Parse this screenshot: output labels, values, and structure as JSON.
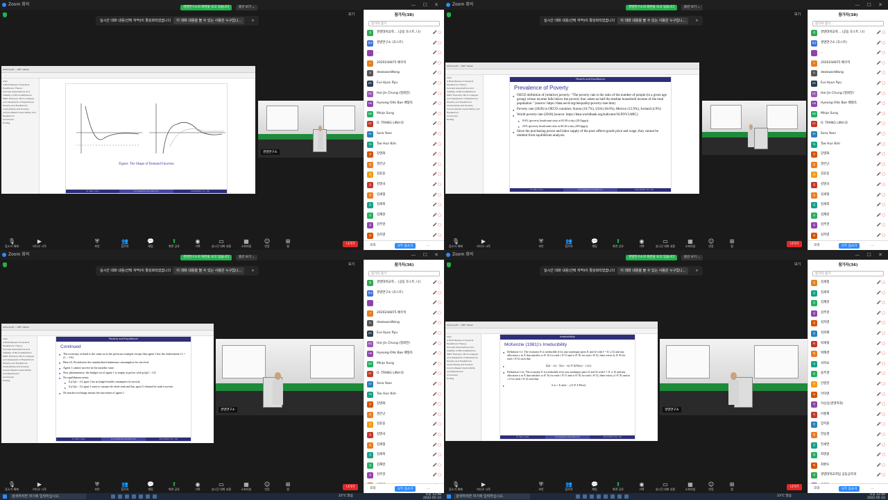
{
  "zoom": {
    "window_title": "Zoom 회의",
    "green_banner": "경영연구소의 화면을 보고 있습니다",
    "view_options": "옵션 보기 ⌄",
    "view_label": "보기",
    "caption_notice": "실시간 대화 내용(선택 자막)이 활성화되었습니다",
    "caption_who": "이 대화 내용을 볼 수 있는 사람은 누구입니...",
    "close": "×",
    "video_name": "경영연구소",
    "leave_label": "나가기"
  },
  "toolbar": {
    "items": [
      {
        "label": "음소거 해제",
        "icon": "mic-icon"
      },
      {
        "label": "비디오 시작",
        "icon": "camera-icon"
      },
      {
        "label": "보안",
        "icon": "shield-icon"
      },
      {
        "label": "참가자",
        "icon": "participants-icon"
      },
      {
        "label": "채팅",
        "icon": "chat-icon"
      },
      {
        "label": "화면 공유",
        "icon": "share-icon"
      },
      {
        "label": "기록",
        "icon": "record-icon"
      },
      {
        "label": "실시간 대화 내용",
        "icon": "cc-icon"
      },
      {
        "label": "소회의실",
        "icon": "breakout-icon"
      },
      {
        "label": "반응",
        "icon": "reaction-icon"
      },
      {
        "label": "앱",
        "icon": "apps-icon"
      }
    ],
    "participant_count_top": "38",
    "participant_count_bottom": "36"
  },
  "panels": {
    "q0": {
      "title": "참가자(38)"
    },
    "q1": {
      "title": "참가자(38)"
    },
    "q2": {
      "title": "참가자(36)"
    },
    "q3": {
      "title": "참가자(36)"
    },
    "search_placeholder": "참가자 찾기",
    "invite": "초대",
    "mute_all": "모두 음소거",
    "more": "...",
    "list_a": [
      {
        "name": "경영대학교학... (공동 호스트, 나)",
        "av": "경",
        "color": "#2fa84f"
      },
      {
        "name": "경영연구소 (호스트)",
        "av": "경영",
        "color": "#3a6fd8"
      },
      {
        "name": "..",
        "av": "",
        "color": "#8e44ad"
      },
      {
        "name": "2020244875 배우미",
        "av": "2",
        "color": "#e67e22"
      },
      {
        "name": "deokwonWang",
        "av": "D",
        "color": "#555"
      },
      {
        "name": "Eui-Hyun Ryu",
        "av": "ER",
        "color": "#2c3e50"
      },
      {
        "name": "Hoi-Jin Chung (정회진)",
        "av": "HC",
        "color": "#9b59b6"
      },
      {
        "name": "Hyeong-Ohk Bae 배형옥",
        "av": "HB",
        "color": "#8e44ad"
      },
      {
        "name": "Minje Sung",
        "av": "MS",
        "color": "#27ae60"
      },
      {
        "name": "O. TRANG LINH D",
        "av": "OT",
        "color": "#c0392b"
      },
      {
        "name": "Sora Yoon",
        "av": "SY",
        "color": "#2980b9"
      },
      {
        "name": "Tae Hun Kim",
        "av": "TK",
        "color": "#16a085"
      },
      {
        "name": "강영화",
        "av": "강",
        "color": "#d35400"
      },
      {
        "name": "권은난",
        "av": "권",
        "color": "#e67e22"
      },
      {
        "name": "김윤웅",
        "av": "김",
        "color": "#f39c12"
      },
      {
        "name": "김영국",
        "av": "김",
        "color": "#c0392b"
      },
      {
        "name": "김세형",
        "av": "김",
        "color": "#e67e22"
      },
      {
        "name": "김세희",
        "av": "김",
        "color": "#16a085"
      },
      {
        "name": "김재현",
        "av": "김",
        "color": "#27ae60"
      },
      {
        "name": "김주현",
        "av": "김",
        "color": "#8e44ad"
      },
      {
        "name": "김지영",
        "av": "김",
        "color": "#d35400"
      }
    ],
    "list_b": [
      {
        "name": "경영대학교학... (공동 호스트, 나)",
        "av": "경",
        "color": "#2fa84f"
      },
      {
        "name": "경영연구소 (호스트)",
        "av": "경영",
        "color": "#3a6fd8"
      },
      {
        "name": "..",
        "av": "",
        "color": "#8e44ad"
      },
      {
        "name": "2020244875 배우미",
        "av": "2",
        "color": "#e67e22"
      },
      {
        "name": "deokwonWang",
        "av": "D",
        "color": "#555"
      },
      {
        "name": "Eui-Hyun Ryu",
        "av": "ER",
        "color": "#2c3e50"
      },
      {
        "name": "Hoi-Jin Chung (정회진)",
        "av": "HC",
        "color": "#9b59b6"
      },
      {
        "name": "Hyeong-Ohk Bae 배형옥",
        "av": "HB",
        "color": "#8e44ad"
      },
      {
        "name": "Minje Sung",
        "av": "MS",
        "color": "#27ae60"
      },
      {
        "name": "O. TRANG LINH D",
        "av": "OT",
        "color": "#c0392b"
      },
      {
        "name": "Sora Yoon",
        "av": "SY",
        "color": "#2980b9"
      },
      {
        "name": "Tae Hun Kim",
        "av": "TK",
        "color": "#16a085"
      },
      {
        "name": "강영화",
        "av": "강",
        "color": "#d35400"
      },
      {
        "name": "권은난",
        "av": "권",
        "color": "#e67e22"
      },
      {
        "name": "김윤웅",
        "av": "김",
        "color": "#f39c12"
      },
      {
        "name": "김영국",
        "av": "김",
        "color": "#c0392b"
      },
      {
        "name": "김세형",
        "av": "김",
        "color": "#e67e22"
      },
      {
        "name": "김세희",
        "av": "김",
        "color": "#16a085"
      },
      {
        "name": "김재현",
        "av": "김",
        "color": "#27ae60"
      },
      {
        "name": "김주현",
        "av": "김",
        "color": "#8e44ad"
      },
      {
        "name": "김지영",
        "av": "김",
        "color": "#d35400"
      },
      {
        "name": "김희영",
        "av": "김",
        "color": "#2980b9"
      }
    ],
    "list_c": [
      {
        "name": "김세형",
        "av": "김",
        "color": "#e67e22"
      },
      {
        "name": "김세희",
        "av": "김",
        "color": "#16a085"
      },
      {
        "name": "김재현",
        "av": "김",
        "color": "#27ae60"
      },
      {
        "name": "김주현",
        "av": "김",
        "color": "#8e44ad"
      },
      {
        "name": "김지영",
        "av": "김",
        "color": "#d35400"
      },
      {
        "name": "김희재",
        "av": "김",
        "color": "#2980b9"
      },
      {
        "name": "박세형",
        "av": "박",
        "color": "#c0392b"
      },
      {
        "name": "박혜경",
        "av": "박",
        "color": "#e67e22"
      },
      {
        "name": "서지요",
        "av": "서",
        "color": "#16a085"
      },
      {
        "name": "송주경",
        "av": "송",
        "color": "#27ae60"
      },
      {
        "name": "안정현",
        "av": "안",
        "color": "#f39c12"
      },
      {
        "name": "이덕영",
        "av": "이",
        "color": "#d35400"
      },
      {
        "name": "이상심(경영학과)",
        "av": "이",
        "color": "#8e44ad"
      },
      {
        "name": "이홍재",
        "av": "이",
        "color": "#c0392b"
      },
      {
        "name": "장지원",
        "av": "장",
        "color": "#2980b9"
      },
      {
        "name": "한승결",
        "av": "한",
        "color": "#e67e22"
      },
      {
        "name": "전세연",
        "av": "전",
        "color": "#16a085"
      },
      {
        "name": "최영광",
        "av": "최",
        "color": "#27ae60"
      },
      {
        "name": "최환오",
        "av": "최",
        "color": "#d35400"
      },
      {
        "name": "경영대학교학팀 공동공학과",
        "av": "경",
        "color": "#2fa84f"
      },
      {
        "name": "고혜정",
        "av": "고",
        "color": "#8e44ad"
      }
    ]
  },
  "slides": {
    "q0": {
      "caption": "Figure: The Shape of Demand Function",
      "footer": [
        "D. Won (AU)",
        "Competitive Equilibrium",
        "10/1/2022   11 / 40"
      ]
    },
    "q1": {
      "header": "Poverty and Equilibrium",
      "title": "Prevalence of Poverty",
      "bullets": [
        {
          "text": "OECD definition of (relative) poverty: \"The poverty rate is the ratio of the number of people (in a given age group) whose income falls below the poverty line; taken as half the median household income of the total population.\" (source: https://data.oecd.org/inequality/poverty-rate.htm)",
          "sub": false
        },
        {
          "text": "Poverty rate (2020) in OECD countries: Korea (16.7%), USA (18.0%), Mexico (15.9%), Iceland (4.9%)",
          "sub": false
        },
        {
          "text": "World poverty rate (2018) (source: https://data.worldbank.org/indicator/SI.POV.LMIC)",
          "sub": false
        },
        {
          "text": "8.6% (poverty headcount ratio at $1.90 a day (2011ppp))",
          "sub": true
        },
        {
          "text": "23% (poverty headcount ratio at $3.20 a day (2011ppp))",
          "sub": true
        },
        {
          "text": "Since the purchasing power and labor supply of the poor affects goods price and wage, they cannot be omitted from equilibrium analysis.",
          "sub": false
        }
      ],
      "footer": [
        "D. Won (AU)",
        "Competitive Equilibrium",
        "10/1/2022   19 / 40"
      ]
    },
    "q2": {
      "header": "Poverty and Equilibrium",
      "title": "Continued",
      "bullets": [
        {
          "text": "The economy at hand is the same as in the previous example except that agent 1 has the endowment e1 = (1, −1/4).",
          "sub": false
        },
        {
          "text": "Here (0, 0) indicates the standardized minimum consumption for survival.",
          "sub": false
        },
        {
          "text": "Agent 1 cannot survive in the autarkic state.",
          "sub": false
        },
        {
          "text": "New phenomenon: the budget set of agent 1 is empty at prices with p1/p2 < 1/4.",
          "sub": false
        },
        {
          "text": "No equilibrium exists:",
          "sub": false
        },
        {
          "text": "If p1/p2 < 1/4, agent 1 has no budget-feasible consumption for survival.",
          "sub": true
        },
        {
          "text": "If p1/p2 ≥ 1/4, agent 2 wants to consume the whole steak and thus, agent 1's demand for steak is not met.",
          "sub": true
        },
        {
          "text": "No market exchange means the starvation of agent 1.",
          "sub": false
        }
      ],
      "footer": [
        "D. Won (AU)",
        "Competitive Equilibrium",
        "10/1/2022   21 / 40"
      ]
    },
    "q3": {
      "header": "Irreducibility",
      "title": "McKenzie (1981)'s Irreducibility",
      "bullets": [
        {
          "text": "Definition 3.1: The economy E is irreducible if for any nonempty pairs I1 and I2 with I = I1 ∪ I2 and any allocation x in Â that satisfies xi ∈ Xi for each i ∈ I1 and xi ∈ X̄i for each i ∈ I2, there exists ξi ∈ X̄i for each i ∈ I2 such that",
          "sub": false
        },
        {
          "text": "Σ(ξi − ei) − Σ(xi − ei) ∈ Σ(Pi(xi) − {xi}).",
          "sub": true
        },
        {
          "text": "Definition 3.1a: The economy E is irreducible if for any nonempty pairs I1 and I2 with I = I1 ∪ I2 and any allocation x in Â that satisfies xi ∈ Xi for each i ∈ I1 and xi ∈ X̄i for each i ∈ I2, there exists yi' ∈ X̄i and αi ≥ 0 for each i ∈ I2 such that",
          "sub": false
        },
        {
          "text": "Σ xi + Σ αi(ei − yi') ∈ Σ Pi(xi).",
          "sub": true
        }
      ],
      "footer": [
        "D. Won (AU)",
        "Competitive Equilibrium",
        "10/1/2022   24 / 40"
      ]
    },
    "outline_items": [
      "Intro",
      "A Brief Review of General Equilibrium Theory",
      "Survival Assumptions and Viability of Microinstitutions",
      "MWT Theorem; Micro Analysis and Viewpoints of Equilibrium",
      "Poverty and Equilibrium",
      "Irreducibility and Poverty",
      "Income Based Irreducibility and Equilibrium",
      "Conclusion",
      "Ending"
    ]
  },
  "taskbar": {
    "search_placeholder": "검색하려면 여기에 입력하십시오.",
    "weather_left": "23°C 맑음",
    "weather_right": "23°C 맑음",
    "time_left": "오후 12:48",
    "date_left": "2022-05-10",
    "time_right": "오후 12:49",
    "date_right": "2022-05-10"
  }
}
